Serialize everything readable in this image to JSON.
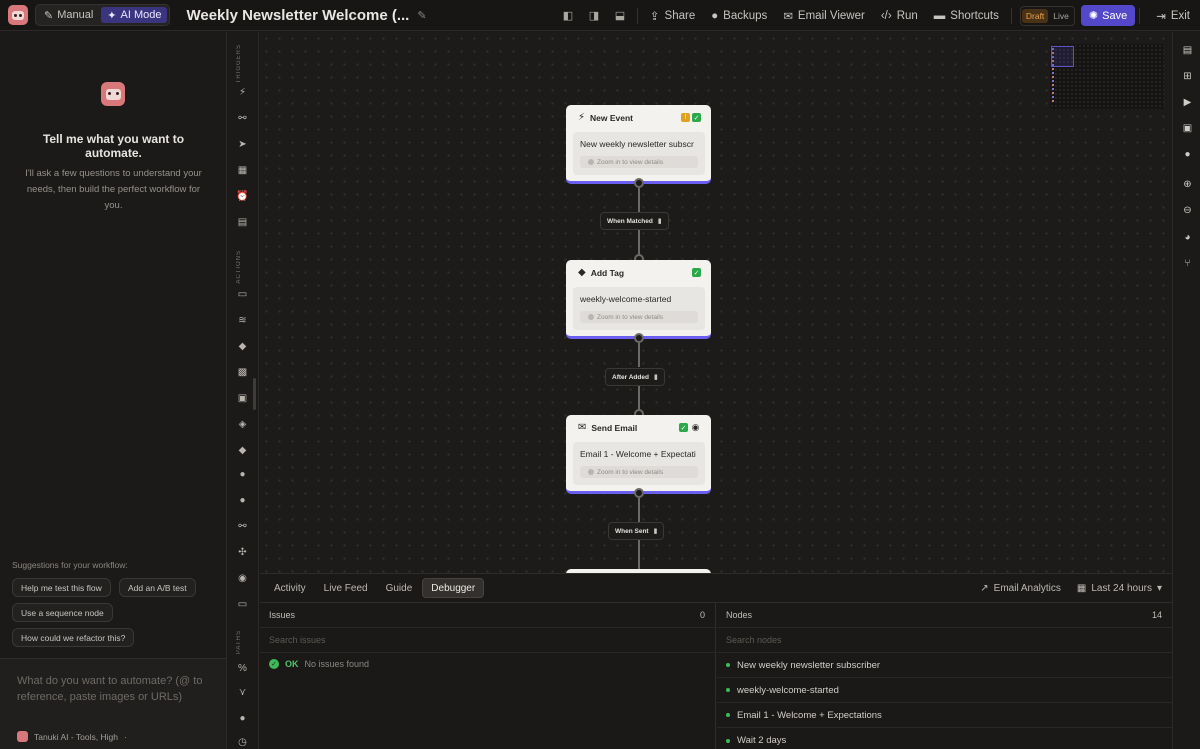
{
  "topbar": {
    "modes": [
      {
        "label": "Manual",
        "icon": "pencil-icon"
      },
      {
        "label": "AI Mode",
        "icon": "sparkle-icon",
        "active": true
      }
    ],
    "title": "Weekly Newsletter Welcome (...",
    "actions": [
      "Share",
      "Backups",
      "Email Viewer",
      "Run",
      "Shortcuts"
    ],
    "status": {
      "draft": "Draft",
      "live": "Live"
    },
    "save": "Save",
    "exit": "Exit"
  },
  "ai_panel": {
    "heading": "Tell me what you want to automate.",
    "subtext": "I'll ask a few questions to understand your needs, then build the perfect workflow for you.",
    "suggestions_label": "Suggestions for your workflow:",
    "suggestions": [
      "Help me test this flow",
      "Add an A/B test",
      "Use a sequence node",
      "How could we refactor this?"
    ],
    "prompt_placeholder": "What do you want to automate? (@ to reference, paste images or URLs)",
    "model": "Tanuki AI - Tools, High"
  },
  "palette": {
    "sections": [
      "TRIGGERS",
      "ACTIONS",
      "PATHS"
    ]
  },
  "canvas": {
    "nodes": [
      {
        "title": "New Event",
        "value": "New weekly newsletter subscr",
        "hint": "Zoom in to view details"
      },
      {
        "title": "Add Tag",
        "value": "weekly-welcome-started",
        "hint": "Zoom in to view details"
      },
      {
        "title": "Send Email",
        "value": "Email 1 - Welcome + Expectati",
        "hint": "Zoom in to view details"
      }
    ],
    "edges": [
      "When Matched",
      "After Added",
      "When Sent"
    ]
  },
  "bottom": {
    "tabs": [
      "Activity",
      "Live Feed",
      "Guide",
      "Debugger"
    ],
    "active_tab": "Debugger",
    "email_analytics": "Email Analytics",
    "range": "Last 24 hours",
    "issues": {
      "title": "Issues",
      "count": "0",
      "search_placeholder": "Search issues",
      "status": "OK",
      "message": "No issues found"
    },
    "nodes": {
      "title": "Nodes",
      "count": "14",
      "search_placeholder": "Search nodes",
      "items": [
        "New weekly newsletter subscriber",
        "weekly-welcome-started",
        "Email 1 - Welcome + Expectations",
        "Wait 2 days"
      ]
    }
  },
  "colors": {
    "accent": "#5348c9",
    "draft": "#e9a24c",
    "ok": "#3fb95a",
    "node_border": "#6a5ff0"
  }
}
